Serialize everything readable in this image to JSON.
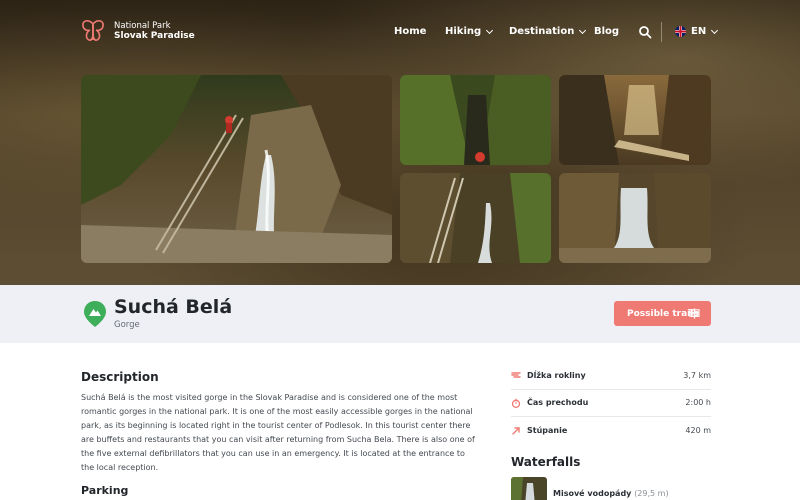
{
  "brand": {
    "line1": "National Park",
    "line2": "Slovak Paradise",
    "color": "#ef7a74"
  },
  "nav": {
    "home": "Home",
    "hiking": "Hiking",
    "destination": "Destination",
    "blog": "Blog",
    "language": "EN"
  },
  "place": {
    "name": "Suchá Belá",
    "type": "Gorge",
    "trails_button": "Possible trails"
  },
  "description": {
    "heading": "Description",
    "text": "Suchá Belá is the most visited gorge in the Slovak Paradise and is considered one of the most romantic gorges in the national park. It is one of the most easily accessible gorges in the national park, as its beginning is located right in the tourist center of Podlesok. In this tourist center there are buffets and restaurants that you can visit after returning from Sucha Bela. There is also one of the five external defibrillators that you can use in an emergency. It is located at the entrance to the local reception."
  },
  "parking": {
    "heading": "Parking"
  },
  "stats": [
    {
      "icon": "gorge-length-icon",
      "label": "Dĺžka rokliny",
      "value": "3,7 km"
    },
    {
      "icon": "stopwatch-icon",
      "label": "Čas prechodu",
      "value": "2:00 h"
    },
    {
      "icon": "ascent-arrow-icon",
      "label": "Stúpanie",
      "value": "420 m"
    }
  ],
  "waterfalls": {
    "heading": "Waterfalls",
    "items": [
      {
        "name": "Misové vodopády",
        "length": "(29,5 m)"
      }
    ]
  },
  "colors": {
    "accent": "#ef7a74",
    "pin_green": "#3fae5a",
    "band": "#eef0f5"
  }
}
